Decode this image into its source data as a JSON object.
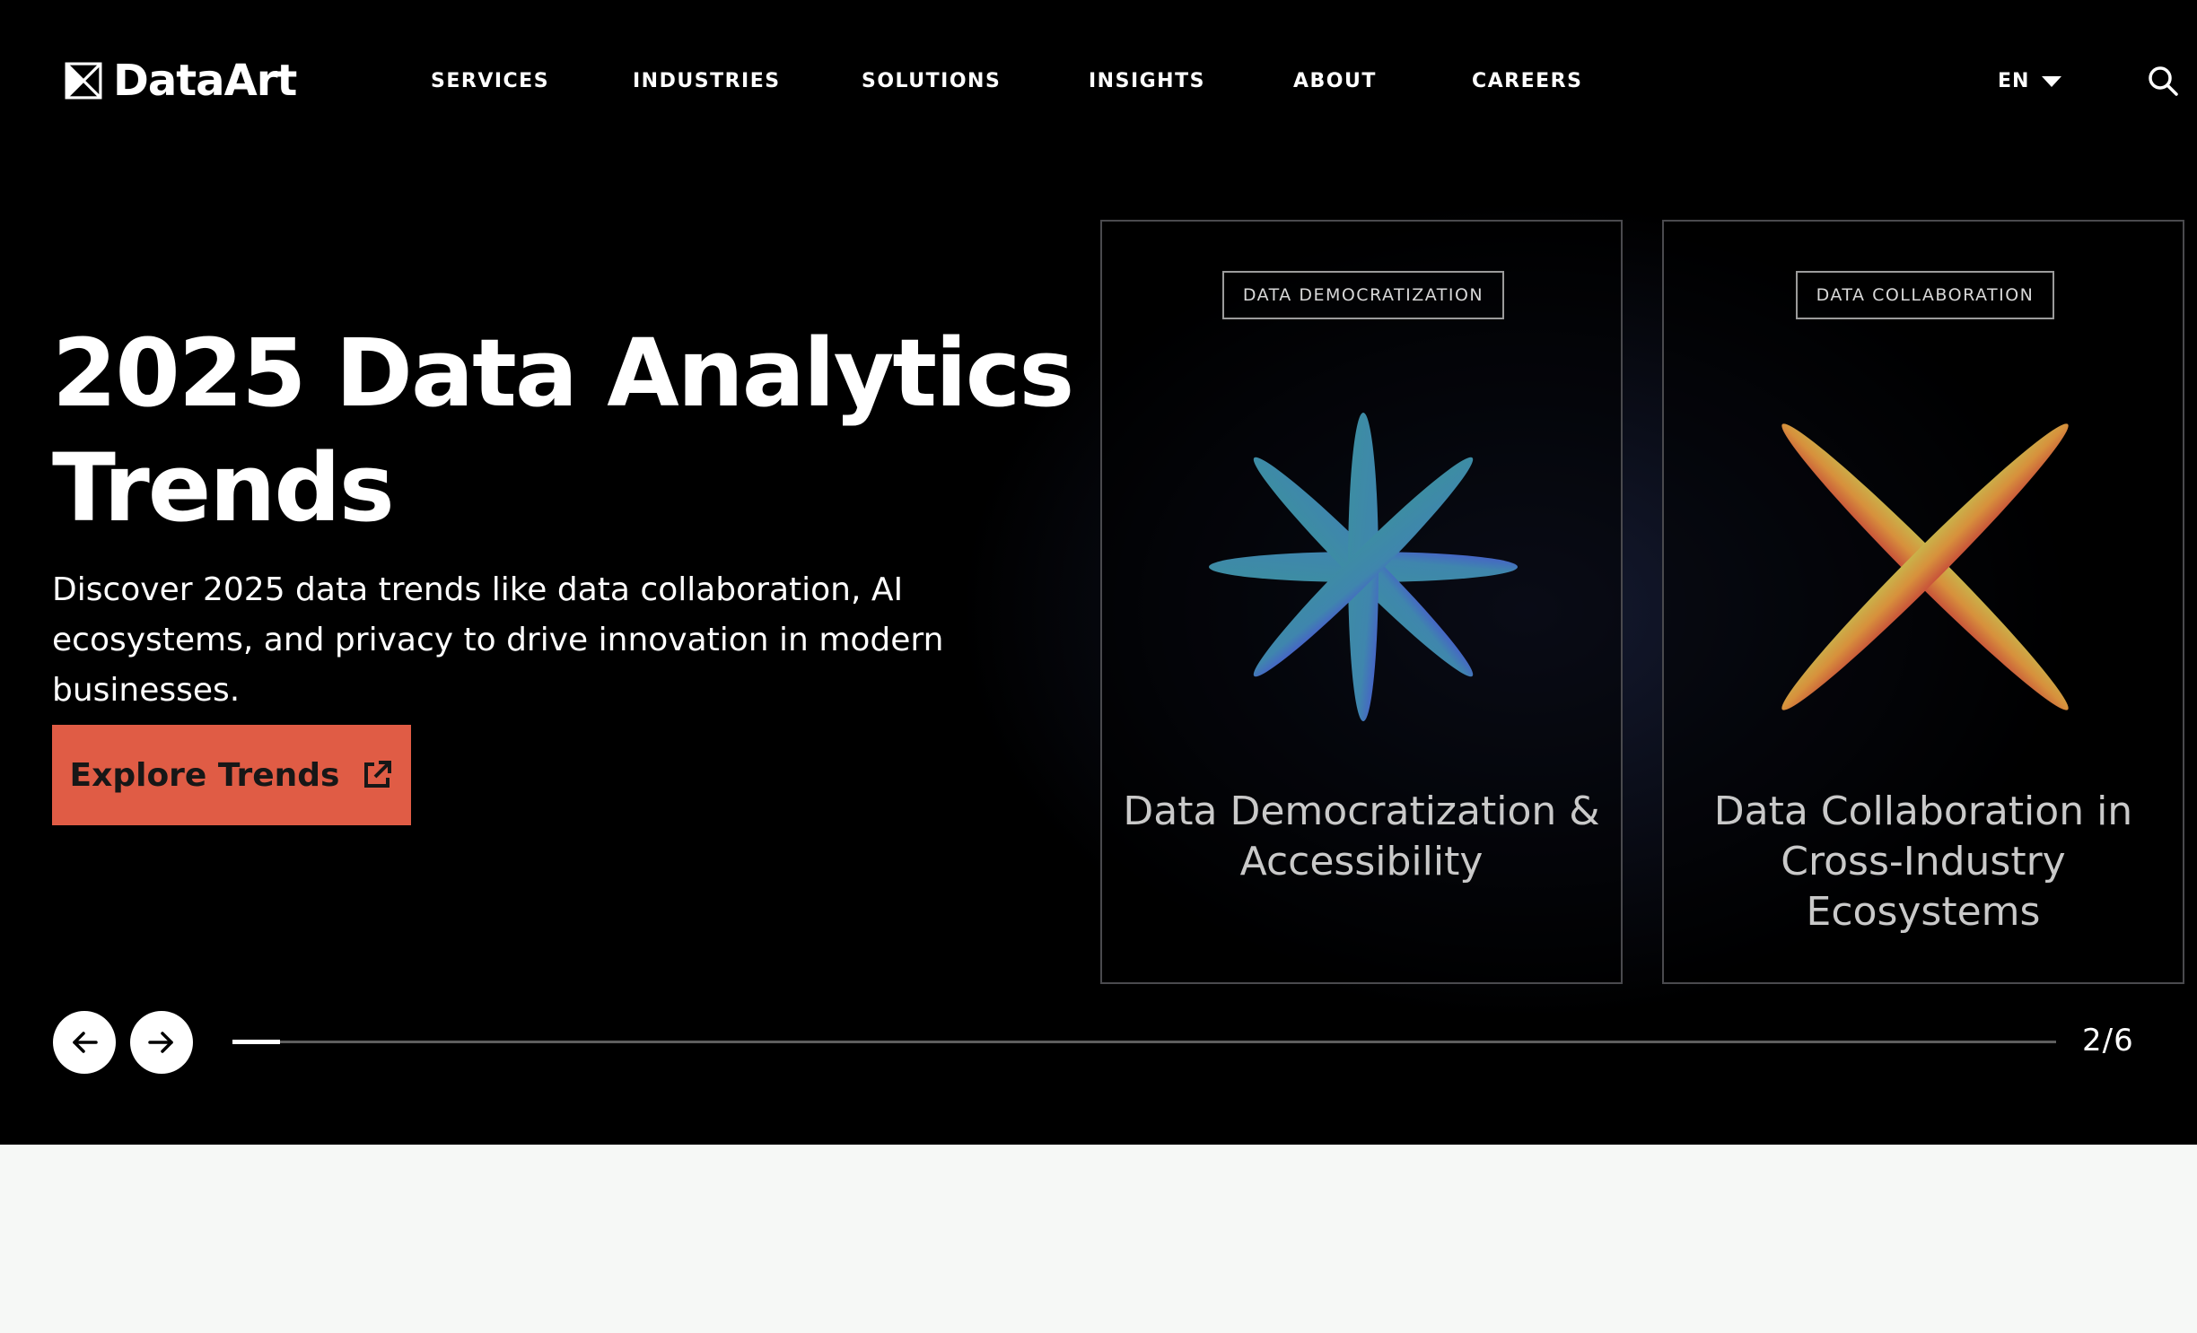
{
  "header": {
    "logo_text": "DataArt",
    "nav": [
      "SERVICES",
      "INDUSTRIES",
      "SOLUTIONS",
      "INSIGHTS",
      "ABOUT",
      "CAREERS"
    ],
    "language": "EN"
  },
  "hero": {
    "title": "2025 Data Analytics Trends",
    "description": "Discover 2025 data trends like data collaboration, AI ecosystems, and privacy to drive innovation in modern businesses.",
    "cta_label": "Explore Trends"
  },
  "cards": [
    {
      "tag": "DATA DEMOCRATIZATION",
      "title": "Data Democratization & Accessibility",
      "art": "asterisk-flower",
      "colors": [
        "#3c8fa0",
        "#4b4fd6"
      ]
    },
    {
      "tag": "DATA COLLABORATION",
      "title": "Data Collaboration in Cross-Industry Ecosystems",
      "art": "x-cross",
      "colors": [
        "#c9b24a",
        "#d05a3a"
      ]
    }
  ],
  "carousel": {
    "counter": "2/6",
    "progress_fraction": 0.026
  },
  "colors": {
    "accent": "#e05c45",
    "background": "#000000",
    "page_below": "#f6f8f6"
  }
}
